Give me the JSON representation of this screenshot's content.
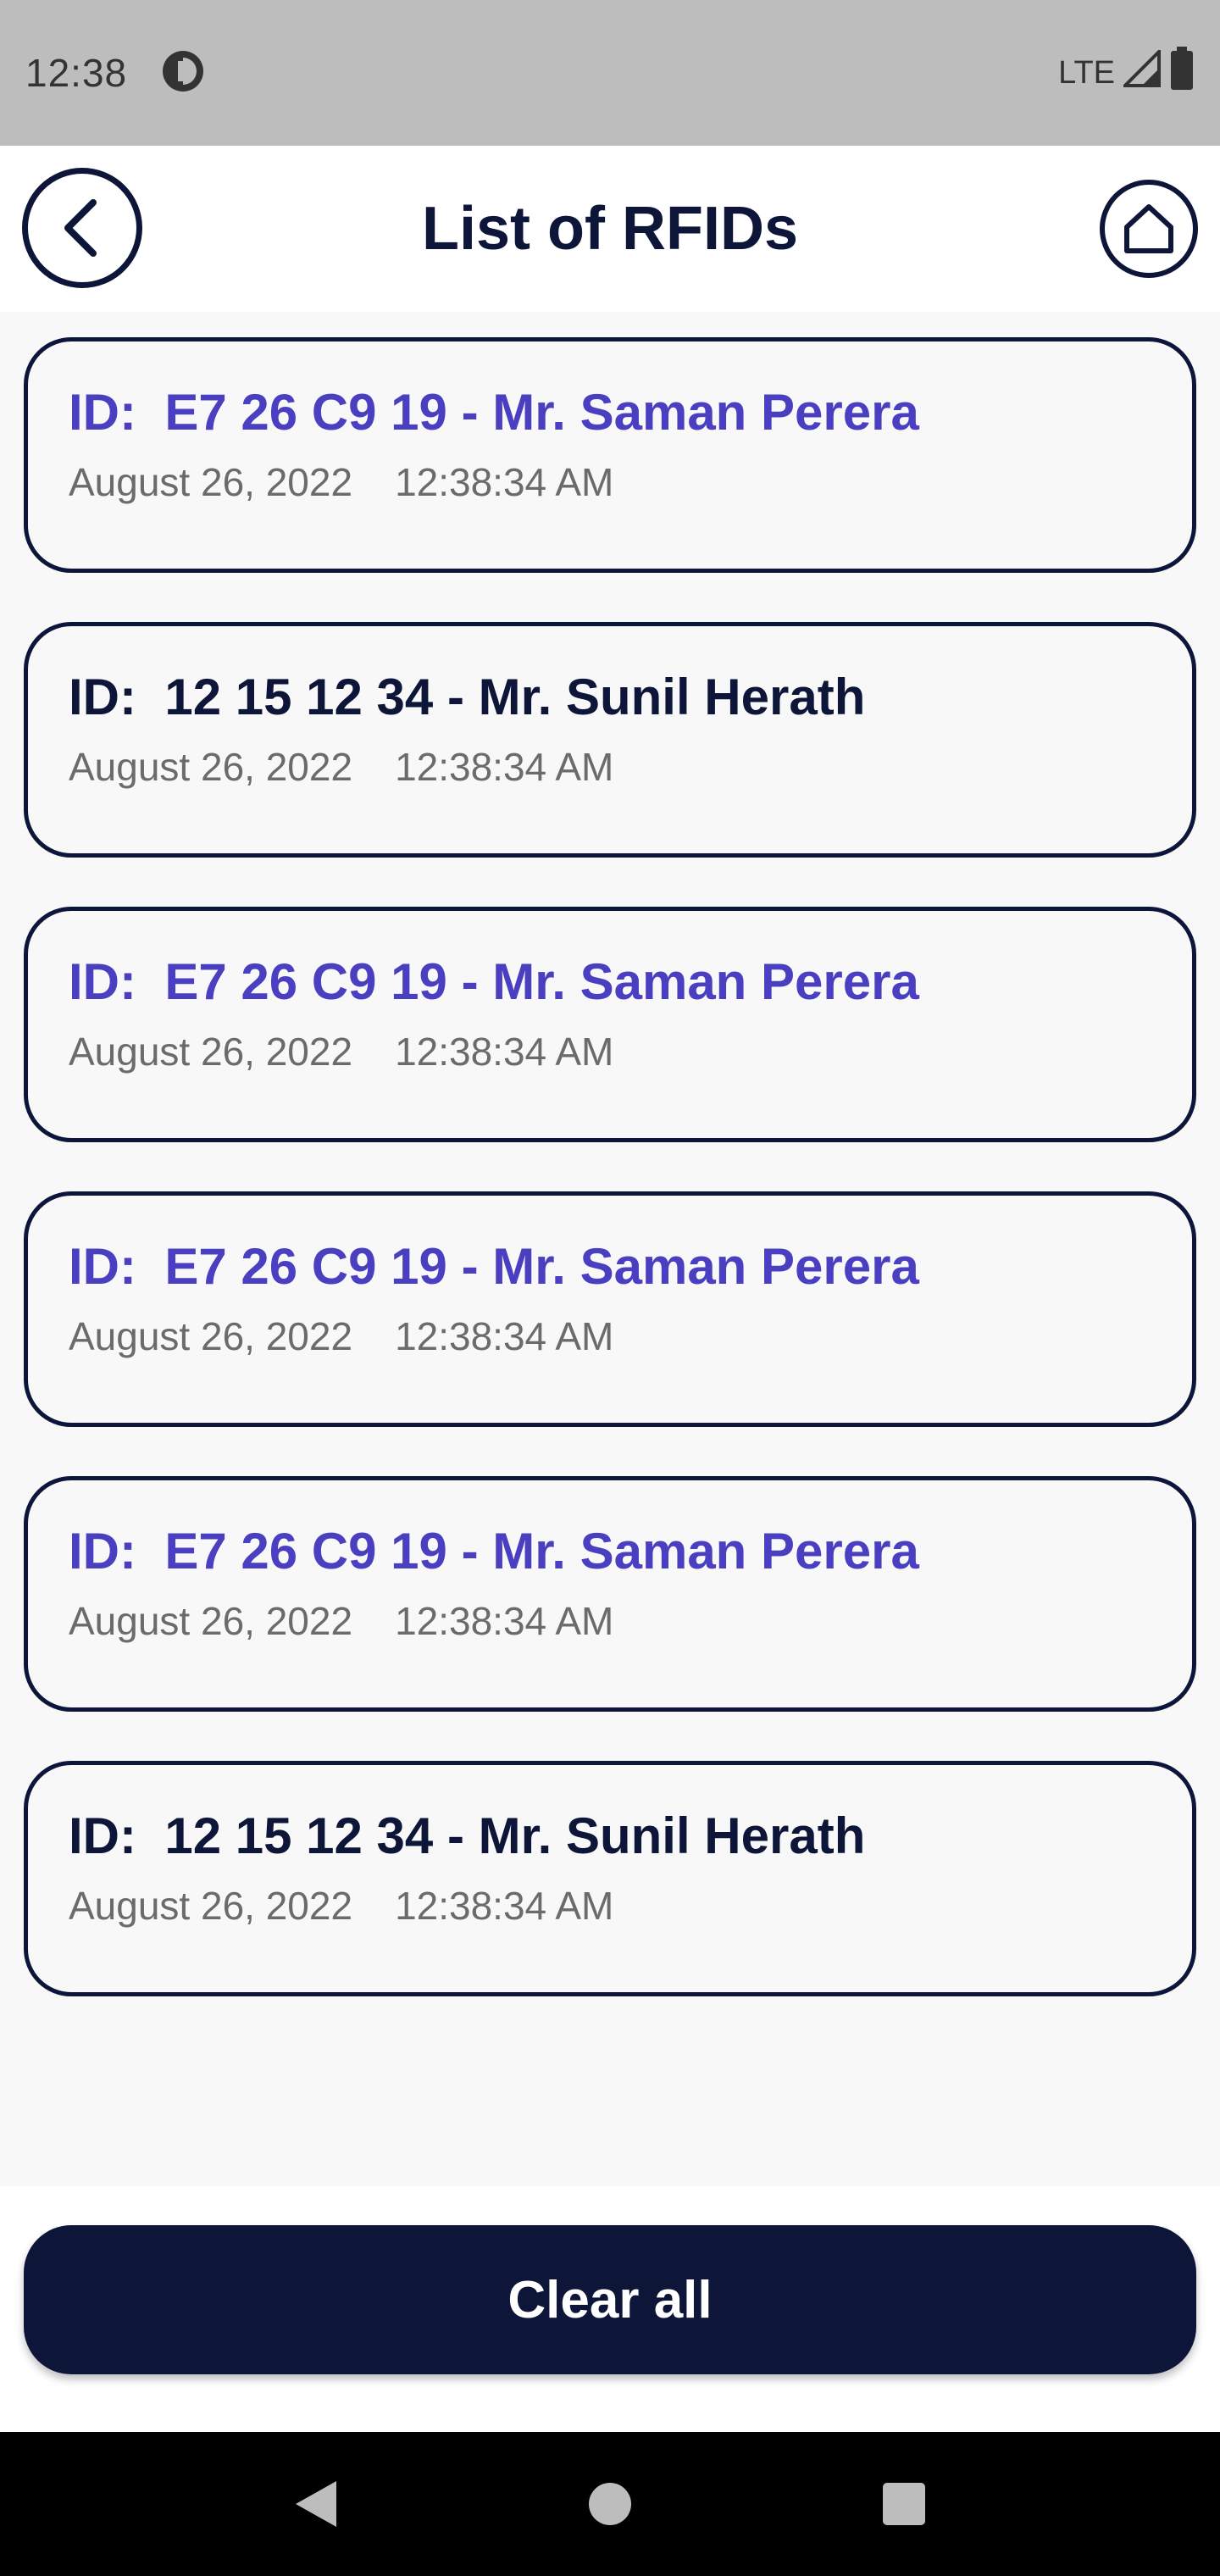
{
  "status_bar": {
    "time": "12:38",
    "network": "LTE"
  },
  "header": {
    "title": "List of RFIDs"
  },
  "rfid_list": [
    {
      "id_label": "ID:  E7 26 C9 19 - Mr. Saman Perera",
      "date": "August 26, 2022",
      "time": "12:38:34 AM",
      "color": "#4a3fc0"
    },
    {
      "id_label": "ID:  12 15 12 34 - Mr. Sunil Herath",
      "date": "August 26, 2022",
      "time": "12:38:34 AM",
      "color": "#0d1538"
    },
    {
      "id_label": "ID:  E7 26 C9 19 - Mr. Saman Perera",
      "date": "August 26, 2022",
      "time": "12:38:34 AM",
      "color": "#4a3fc0"
    },
    {
      "id_label": "ID:  E7 26 C9 19 - Mr. Saman Perera",
      "date": "August 26, 2022",
      "time": "12:38:34 AM",
      "color": "#4a3fc0"
    },
    {
      "id_label": "ID:  E7 26 C9 19 - Mr. Saman Perera",
      "date": "August 26, 2022",
      "time": "12:38:34 AM",
      "color": "#4a3fc0"
    },
    {
      "id_label": "ID:  12 15 12 34 - Mr. Sunil Herath",
      "date": "August 26, 2022",
      "time": "12:38:34 AM",
      "color": "#0d1538"
    }
  ],
  "actions": {
    "clear_all_label": "Clear all"
  },
  "colors": {
    "primary": "#0d1538",
    "accent": "#4a3fc0",
    "muted_text": "#6b6b6b"
  }
}
